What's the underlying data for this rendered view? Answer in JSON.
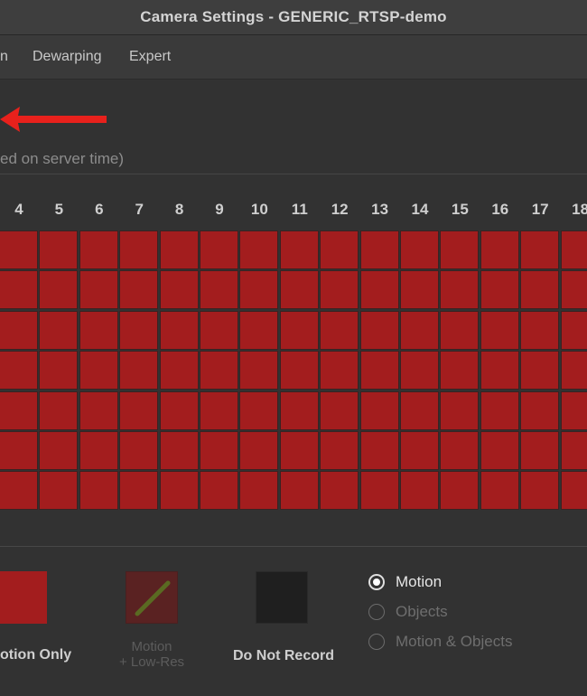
{
  "window": {
    "title": "Camera Settings - GENERIC_RTSP-demo"
  },
  "tabs": [
    {
      "label": "n"
    },
    {
      "label": "Dewarping"
    },
    {
      "label": "Expert"
    }
  ],
  "schedule": {
    "timezone_note": "ed on server time)",
    "hours": [
      "4",
      "5",
      "6",
      "7",
      "8",
      "9",
      "10",
      "11",
      "12",
      "13",
      "14",
      "15",
      "16",
      "17",
      "18"
    ],
    "rows": 7
  },
  "legend": {
    "motion_only": "otion Only",
    "motion_lowres_line1": "Motion",
    "motion_lowres_line2": "+ Low-Res",
    "do_not_record": "Do Not Record"
  },
  "detection": {
    "options": [
      {
        "label": "Motion",
        "checked": true
      },
      {
        "label": "Objects",
        "checked": false
      },
      {
        "label": "Motion & Objects",
        "checked": false
      }
    ]
  },
  "colors": {
    "record_cell": "#a31d1e",
    "arrow": "#e8211c"
  }
}
